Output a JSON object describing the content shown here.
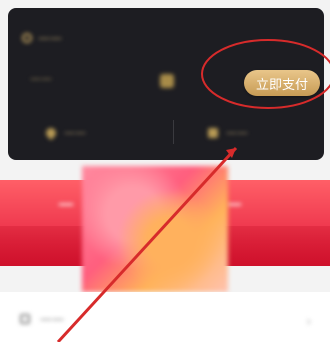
{
  "membership_card": {
    "title_text": "——",
    "subtitle_text": "——",
    "pay_button_label": "立即支付",
    "left_action_label": "——",
    "right_action_label": "——",
    "icons": [
      "badge-icon",
      "small-square-icon",
      "location-icon",
      "gift-icon"
    ]
  },
  "promo_banner": {
    "left_text": "—",
    "right_text": "—",
    "colors": {
      "primary": "#e21a3b",
      "secondary": "#ff5f67"
    }
  },
  "list": {
    "item_label": "——",
    "chevron_icon": "chevron-right-icon"
  },
  "annotation": {
    "color": "#d72b2b"
  }
}
